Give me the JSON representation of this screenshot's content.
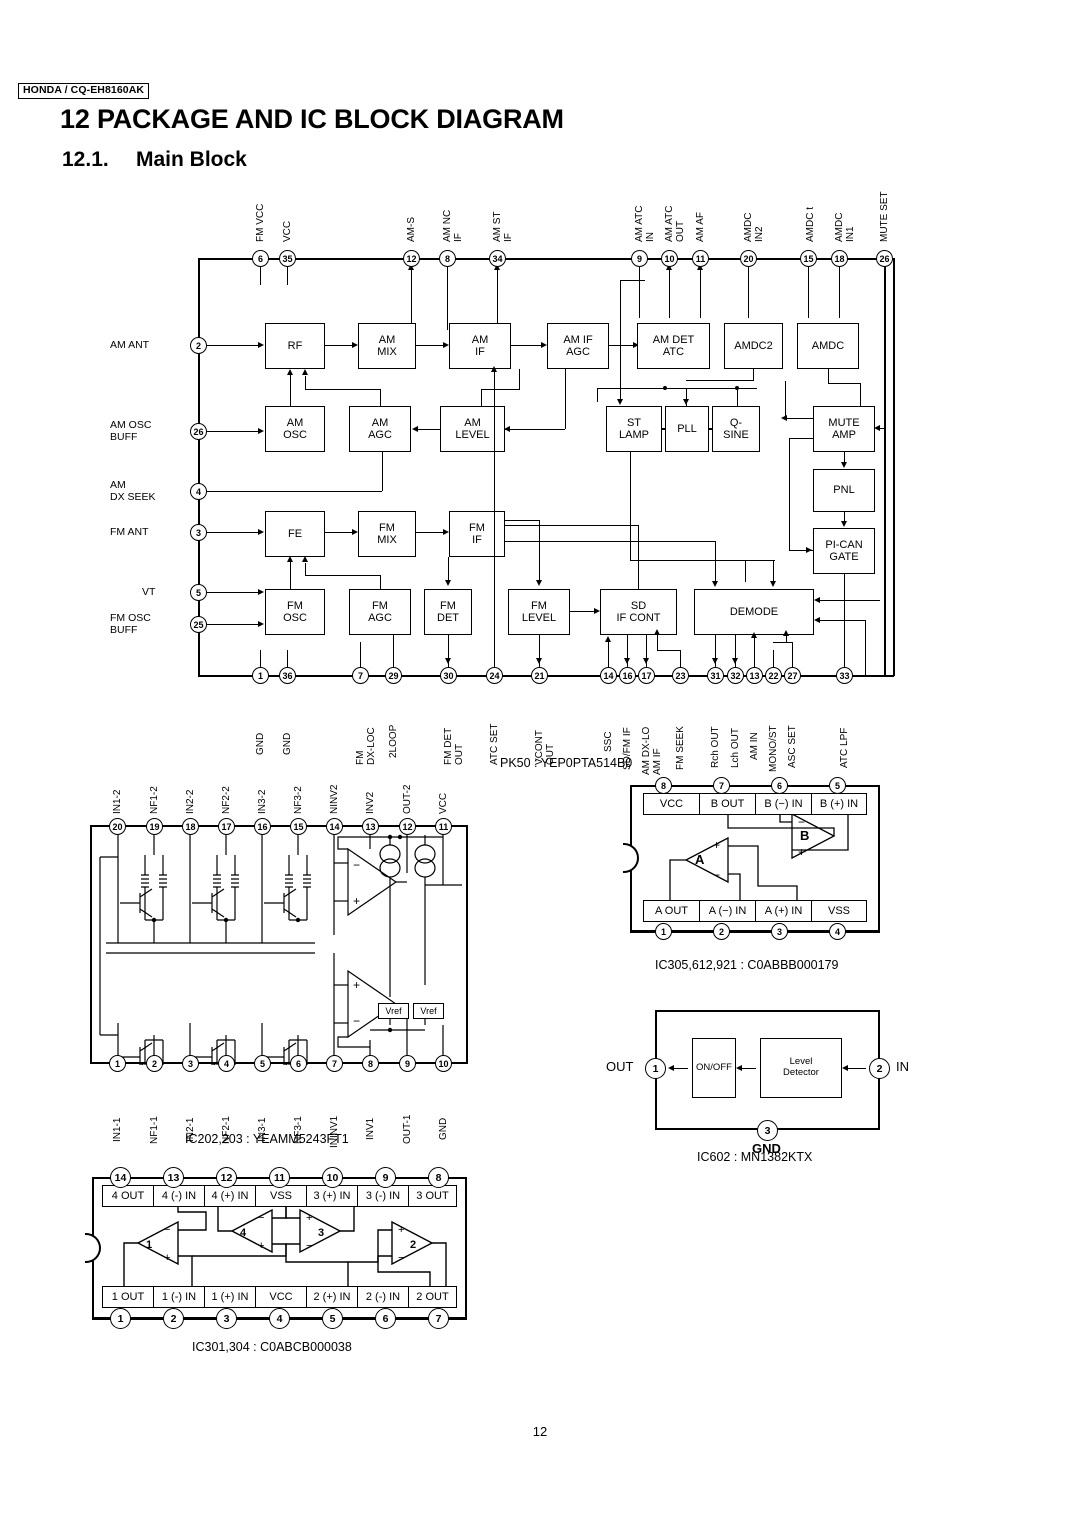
{
  "header": {
    "model": "HONDA / CQ-EH8160AK",
    "chapter_number": "12",
    "chapter_title": "PACKAGE AND IC BLOCK DIAGRAM",
    "section_number": "12.1.",
    "section_title": "Main Block"
  },
  "page_number": "12",
  "main_block": {
    "caption": "PK50 : YEP0PTA514B0",
    "top_pins": [
      {
        "num": "6",
        "label": "FM VCC"
      },
      {
        "num": "35",
        "label": "VCC"
      },
      {
        "num": "12",
        "label": "AM-S"
      },
      {
        "num": "8",
        "label": "AM NC\nIF"
      },
      {
        "num": "34",
        "label": "AM ST\nIF"
      },
      {
        "num": "9",
        "label": "AM ATC\nIN"
      },
      {
        "num": "10",
        "label": "AM ATC\nOUT"
      },
      {
        "num": "11",
        "label": "AM AF"
      },
      {
        "num": "20",
        "label": "AMDC\nIN2"
      },
      {
        "num": "15",
        "label": "AMDC t"
      },
      {
        "num": "18",
        "label": "AMDC\nIN1"
      },
      {
        "num": "26",
        "label": "MUTE SET"
      }
    ],
    "left_pins": [
      {
        "num": "2",
        "label": "AM ANT"
      },
      {
        "num": "26",
        "label": "AM OSC\nBUFF"
      },
      {
        "num": "4",
        "label": "AM\nDX SEEK"
      },
      {
        "num": "3",
        "label": "FM ANT"
      },
      {
        "num": "5",
        "label": "VT"
      },
      {
        "num": "25",
        "label": "FM OSC\nBUFF"
      }
    ],
    "bottom_pins": [
      {
        "num": "1",
        "label": "GND"
      },
      {
        "num": "36",
        "label": "GND"
      },
      {
        "num": "7",
        "label": "FM\nDX-LOC"
      },
      {
        "num": "29",
        "label": "2LOOP"
      },
      {
        "num": "30",
        "label": "FM DET\nOUT"
      },
      {
        "num": "24",
        "label": "ATC SET"
      },
      {
        "num": "21",
        "label": "VCONT\nOUT"
      },
      {
        "num": "14",
        "label": "SSC"
      },
      {
        "num": "16",
        "label": "SD/FM IF"
      },
      {
        "num": "17",
        "label": "AM DX-LO\nAM IF"
      },
      {
        "num": "23",
        "label": "FM SEEK"
      },
      {
        "num": "31",
        "label": "Rch OUT"
      },
      {
        "num": "32",
        "label": "Lch OUT"
      },
      {
        "num": "13",
        "label": "AM IN"
      },
      {
        "num": "22",
        "label": "MONO/ST"
      },
      {
        "num": "27",
        "label": "ASC SET"
      },
      {
        "num": "33",
        "label": "ATC LPF"
      }
    ],
    "blocks": [
      {
        "id": "rf",
        "label": "RF"
      },
      {
        "id": "am_mix",
        "label": "AM\nMIX"
      },
      {
        "id": "am_if",
        "label": "AM\nIF"
      },
      {
        "id": "am_if_agc",
        "label": "AM IF\nAGC"
      },
      {
        "id": "am_det_atc",
        "label": "AM DET\nATC"
      },
      {
        "id": "amdc2",
        "label": "AMDC2"
      },
      {
        "id": "amdc",
        "label": "AMDC"
      },
      {
        "id": "am_osc",
        "label": "AM\nOSC"
      },
      {
        "id": "am_agc",
        "label": "AM\nAGC"
      },
      {
        "id": "am_level",
        "label": "AM\nLEVEL"
      },
      {
        "id": "st_lamp",
        "label": "ST\nLAMP"
      },
      {
        "id": "pll",
        "label": "PLL"
      },
      {
        "id": "q_sine",
        "label": "Q-\nSINE"
      },
      {
        "id": "mute_amp",
        "label": "MUTE\nAMP"
      },
      {
        "id": "pnl",
        "label": "PNL"
      },
      {
        "id": "pi_can_gate",
        "label": "PI-CAN\nGATE"
      },
      {
        "id": "fe",
        "label": "FE"
      },
      {
        "id": "fm_mix",
        "label": "FM\nMIX"
      },
      {
        "id": "fm_if",
        "label": "FM\nIF"
      },
      {
        "id": "fm_osc",
        "label": "FM\nOSC"
      },
      {
        "id": "fm_agc",
        "label": "FM\nAGC"
      },
      {
        "id": "fm_det",
        "label": "FM\nDET"
      },
      {
        "id": "fm_level",
        "label": "FM\nLEVEL"
      },
      {
        "id": "sd_if_cont",
        "label": "SD\nIF CONT"
      },
      {
        "id": "demode",
        "label": "DEMODE"
      }
    ]
  },
  "ic202": {
    "caption": "IC202,203 : YEAMM5243FT1",
    "top_pins": [
      {
        "num": "20",
        "label": "IN1-2"
      },
      {
        "num": "19",
        "label": "NF1-2"
      },
      {
        "num": "18",
        "label": "IN2-2"
      },
      {
        "num": "17",
        "label": "NF2-2"
      },
      {
        "num": "16",
        "label": "IN3-2"
      },
      {
        "num": "15",
        "label": "NF3-2"
      },
      {
        "num": "14",
        "label": "NINV2"
      },
      {
        "num": "13",
        "label": "INV2"
      },
      {
        "num": "12",
        "label": "OUT-2"
      },
      {
        "num": "11",
        "label": "VCC"
      }
    ],
    "bottom_pins": [
      {
        "num": "1",
        "label": "IN1-1"
      },
      {
        "num": "2",
        "label": "NF1-1"
      },
      {
        "num": "3",
        "label": "IN2-1"
      },
      {
        "num": "4",
        "label": "NF2-1"
      },
      {
        "num": "5",
        "label": "IN3-1"
      },
      {
        "num": "6",
        "label": "NF3-1"
      },
      {
        "num": "7",
        "label": "ININV1"
      },
      {
        "num": "8",
        "label": "INV1"
      },
      {
        "num": "9",
        "label": "OUT-1"
      },
      {
        "num": "10",
        "label": "GND"
      }
    ],
    "vref_label": "Vref"
  },
  "ic305": {
    "caption": "IC305,612,921 : C0ABBB000179",
    "top_pins": [
      {
        "num": "8",
        "label": "VCC"
      },
      {
        "num": "7",
        "label": "B  OUT"
      },
      {
        "num": "6",
        "label": "B (−) IN"
      },
      {
        "num": "5",
        "label": "B (+) IN"
      }
    ],
    "bottom_pins": [
      {
        "num": "1",
        "label": "A  OUT"
      },
      {
        "num": "2",
        "label": "A (−) IN"
      },
      {
        "num": "3",
        "label": "A (+) IN"
      },
      {
        "num": "4",
        "label": "VSS"
      }
    ],
    "amps": [
      {
        "id": "a",
        "label": "A"
      },
      {
        "id": "b",
        "label": "B"
      }
    ]
  },
  "ic602": {
    "caption": "IC602 : MN1382KTX",
    "pins": [
      {
        "num": "1",
        "label": "OUT"
      },
      {
        "num": "2",
        "label": "IN"
      },
      {
        "num": "3",
        "label": "GND"
      }
    ],
    "blocks": [
      {
        "id": "onoff",
        "label": "ON/OFF"
      },
      {
        "id": "level_detector",
        "label": "Level\nDetector"
      }
    ]
  },
  "ic301": {
    "caption": "IC301,304 : C0ABCB000038",
    "top_pins": [
      {
        "num": "14",
        "label": "4 OUT"
      },
      {
        "num": "13",
        "label": "4 (-) IN"
      },
      {
        "num": "12",
        "label": "4 (+) IN"
      },
      {
        "num": "11",
        "label": "VSS"
      },
      {
        "num": "10",
        "label": "3 (+) IN"
      },
      {
        "num": "9",
        "label": "3 (-) IN"
      },
      {
        "num": "8",
        "label": "3 OUT"
      }
    ],
    "bottom_pins": [
      {
        "num": "1",
        "label": "1 OUT"
      },
      {
        "num": "2",
        "label": "1 (-) IN"
      },
      {
        "num": "3",
        "label": "1 (+) IN"
      },
      {
        "num": "4",
        "label": "VCC"
      },
      {
        "num": "5",
        "label": "2 (+) IN"
      },
      {
        "num": "6",
        "label": "2 (-) IN"
      },
      {
        "num": "7",
        "label": "2 OUT"
      }
    ],
    "amps": [
      {
        "id": "a1",
        "label": "1"
      },
      {
        "id": "a2",
        "label": "2"
      },
      {
        "id": "a3",
        "label": "3"
      },
      {
        "id": "a4",
        "label": "4"
      }
    ]
  }
}
